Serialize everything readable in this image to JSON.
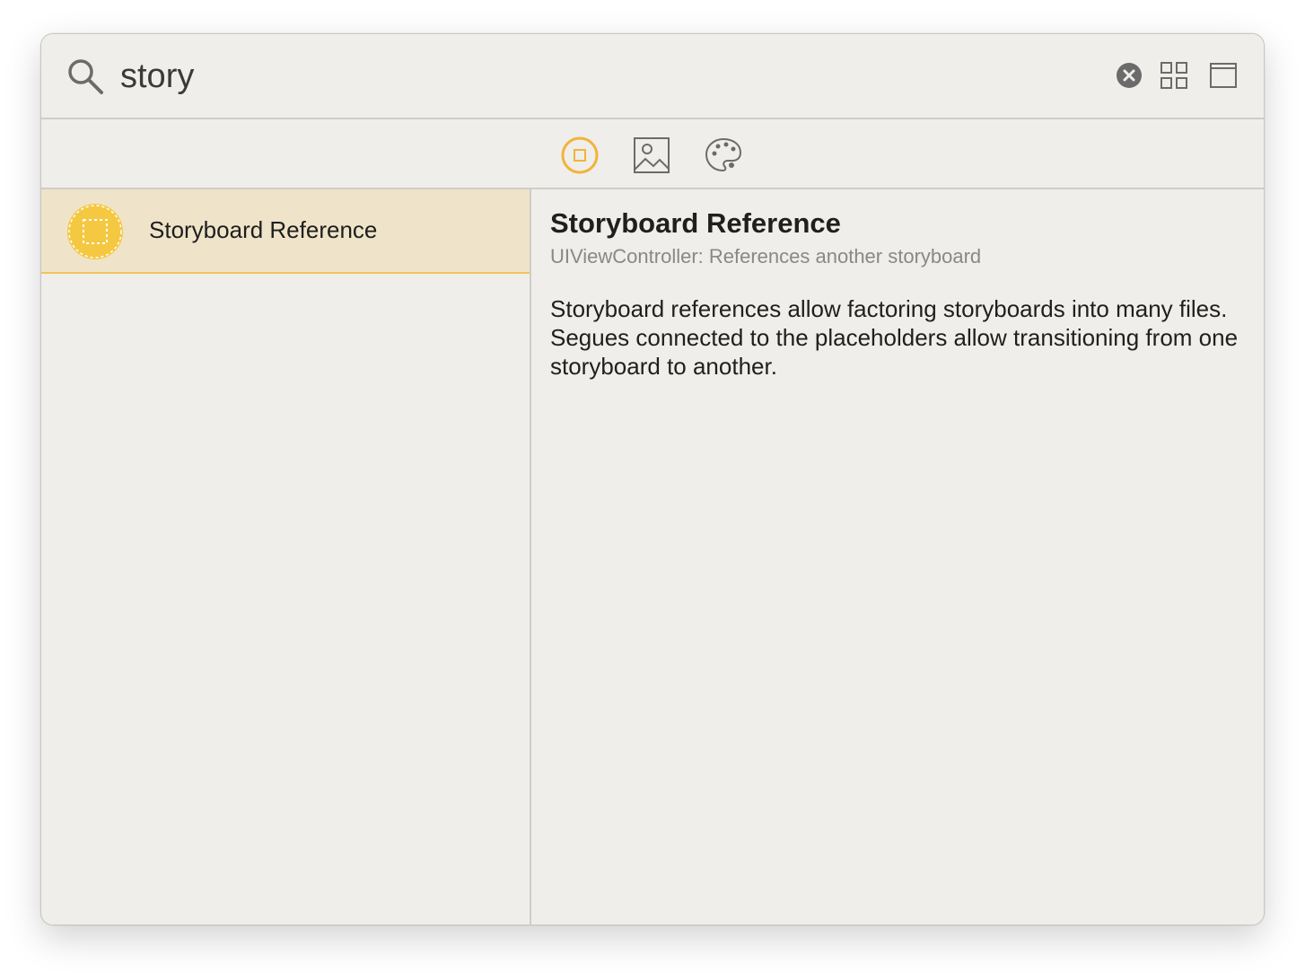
{
  "search": {
    "query": "story",
    "icon": "search-icon"
  },
  "toolbar": {
    "clear_icon": "clear-icon",
    "grid_view_icon": "grid-view-icon",
    "detail_view_icon": "detail-panel-icon"
  },
  "filters": [
    {
      "name": "objects",
      "icon": "object-library-icon",
      "selected": true
    },
    {
      "name": "media",
      "icon": "image-library-icon",
      "selected": false
    },
    {
      "name": "colors",
      "icon": "palette-icon",
      "selected": false
    }
  ],
  "results": [
    {
      "label": "Storyboard Reference",
      "icon": "storyboard-reference-icon",
      "selected": true
    }
  ],
  "detail": {
    "title": "Storyboard Reference",
    "subtitle": "UIViewController: References another storyboard",
    "description": "Storyboard references allow factoring storyboards into many files. Segues connected to the placeholders allow transitioning from one storyboard to another."
  },
  "colors": {
    "accent": "#f0b43c",
    "selection_bg": "#efe4c9",
    "window_bg": "#f0eeea",
    "icon_gray": "#6b6b6b"
  }
}
